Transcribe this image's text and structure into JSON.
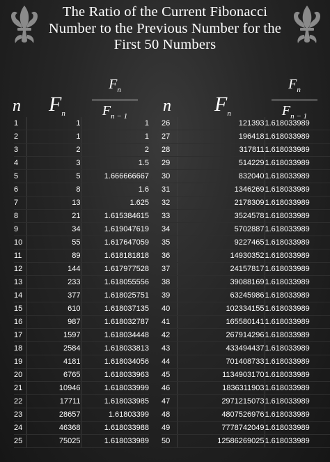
{
  "title": "The Ratio of the Current Fibonacci Number to the Previous Number for the First 50 Numbers",
  "headers": {
    "n": "n",
    "fn_base": "F",
    "fn_sub": "n",
    "ratio_num_base": "F",
    "ratio_num_sub": "n",
    "ratio_den_base": "F",
    "ratio_den_sub": "n − 1"
  },
  "left_rows": [
    {
      "n": "1",
      "f": "1",
      "r": "1"
    },
    {
      "n": "2",
      "f": "1",
      "r": "1"
    },
    {
      "n": "3",
      "f": "2",
      "r": "2"
    },
    {
      "n": "4",
      "f": "3",
      "r": "1.5"
    },
    {
      "n": "5",
      "f": "5",
      "r": "1.666666667"
    },
    {
      "n": "6",
      "f": "8",
      "r": "1.6"
    },
    {
      "n": "7",
      "f": "13",
      "r": "1.625"
    },
    {
      "n": "8",
      "f": "21",
      "r": "1.615384615"
    },
    {
      "n": "9",
      "f": "34",
      "r": "1.619047619"
    },
    {
      "n": "10",
      "f": "55",
      "r": "1.617647059"
    },
    {
      "n": "11",
      "f": "89",
      "r": "1.618181818"
    },
    {
      "n": "12",
      "f": "144",
      "r": "1.617977528"
    },
    {
      "n": "13",
      "f": "233",
      "r": "1.618055556"
    },
    {
      "n": "14",
      "f": "377",
      "r": "1.618025751"
    },
    {
      "n": "15",
      "f": "610",
      "r": "1.618037135"
    },
    {
      "n": "16",
      "f": "987",
      "r": "1.618032787"
    },
    {
      "n": "17",
      "f": "1597",
      "r": "1.618034448"
    },
    {
      "n": "18",
      "f": "2584",
      "r": "1.618033813"
    },
    {
      "n": "19",
      "f": "4181",
      "r": "1.618034056"
    },
    {
      "n": "20",
      "f": "6765",
      "r": "1.618033963"
    },
    {
      "n": "21",
      "f": "10946",
      "r": "1.618033999"
    },
    {
      "n": "22",
      "f": "17711",
      "r": "1.618033985"
    },
    {
      "n": "23",
      "f": "28657",
      "r": "1.61803399"
    },
    {
      "n": "24",
      "f": "46368",
      "r": "1.618033988"
    },
    {
      "n": "25",
      "f": "75025",
      "r": "1.618033989"
    }
  ],
  "right_rows": [
    {
      "n": "26",
      "f": "121393",
      "r": "1.618033989"
    },
    {
      "n": "27",
      "f": "196418",
      "r": "1.618033989"
    },
    {
      "n": "28",
      "f": "317811",
      "r": "1.618033989"
    },
    {
      "n": "29",
      "f": "514229",
      "r": "1.618033989"
    },
    {
      "n": "30",
      "f": "832040",
      "r": "1.618033989"
    },
    {
      "n": "31",
      "f": "1346269",
      "r": "1.618033989"
    },
    {
      "n": "32",
      "f": "2178309",
      "r": "1.618033989"
    },
    {
      "n": "33",
      "f": "3524578",
      "r": "1.618033989"
    },
    {
      "n": "34",
      "f": "5702887",
      "r": "1.618033989"
    },
    {
      "n": "35",
      "f": "9227465",
      "r": "1.618033989"
    },
    {
      "n": "36",
      "f": "14930352",
      "r": "1.618033989"
    },
    {
      "n": "37",
      "f": "24157817",
      "r": "1.618033989"
    },
    {
      "n": "38",
      "f": "39088169",
      "r": "1.618033989"
    },
    {
      "n": "39",
      "f": "63245986",
      "r": "1.618033989"
    },
    {
      "n": "40",
      "f": "102334155",
      "r": "1.618033989"
    },
    {
      "n": "41",
      "f": "165580141",
      "r": "1.618033989"
    },
    {
      "n": "42",
      "f": "267914296",
      "r": "1.618033989"
    },
    {
      "n": "43",
      "f": "433494437",
      "r": "1.618033989"
    },
    {
      "n": "44",
      "f": "701408733",
      "r": "1.618033989"
    },
    {
      "n": "45",
      "f": "1134903170",
      "r": "1.618033989"
    },
    {
      "n": "46",
      "f": "1836311903",
      "r": "1.618033989"
    },
    {
      "n": "47",
      "f": "2971215073",
      "r": "1.618033989"
    },
    {
      "n": "48",
      "f": "4807526976",
      "r": "1.618033989"
    },
    {
      "n": "49",
      "f": "7778742049",
      "r": "1.618033989"
    },
    {
      "n": "50",
      "f": "12586269025",
      "r": "1.618033989"
    }
  ]
}
